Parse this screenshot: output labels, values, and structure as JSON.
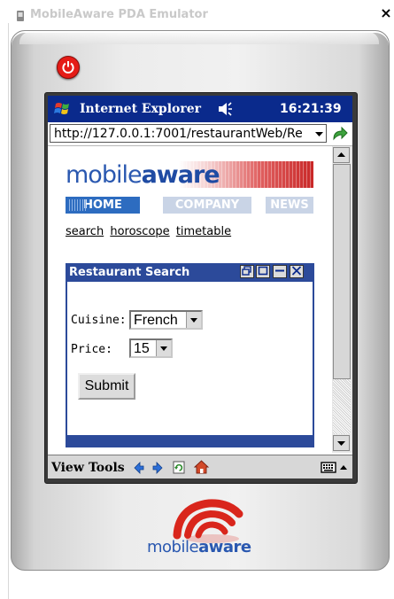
{
  "window": {
    "title": "MobileAware PDA Emulator",
    "close_glyph": "×"
  },
  "device": {
    "power_icon": "power-icon",
    "logo_text_regular": "mobile",
    "logo_text_bold": "aware"
  },
  "pda": {
    "app_title": "Internet Explorer",
    "time": "16:21:39",
    "address": "http://127.0.0.1:7001/restaurantWeb/Re",
    "command_bar": {
      "view": "View",
      "tools": "Tools"
    }
  },
  "page": {
    "brand_regular": "mobile",
    "brand_bold": "aware",
    "nav": [
      {
        "label": "HOME"
      },
      {
        "label": "COMPANY"
      },
      {
        "label": "NEWS"
      }
    ],
    "links": [
      {
        "label": "search"
      },
      {
        "label": "horoscope"
      },
      {
        "label": "timetable"
      }
    ],
    "portlet": {
      "title": "Restaurant Search",
      "cuisine_label": "Cuisine:",
      "cuisine_value": "French",
      "price_label": "Price:",
      "price_value": "15",
      "submit_label": "Submit"
    }
  },
  "colors": {
    "pda_title_bar": "#0a2a8c",
    "brand_blue": "#2a58b0",
    "nav_active": "#2d6cc0",
    "portlet_frame": "#2c4a9a",
    "logo_red": "#d9261c"
  }
}
